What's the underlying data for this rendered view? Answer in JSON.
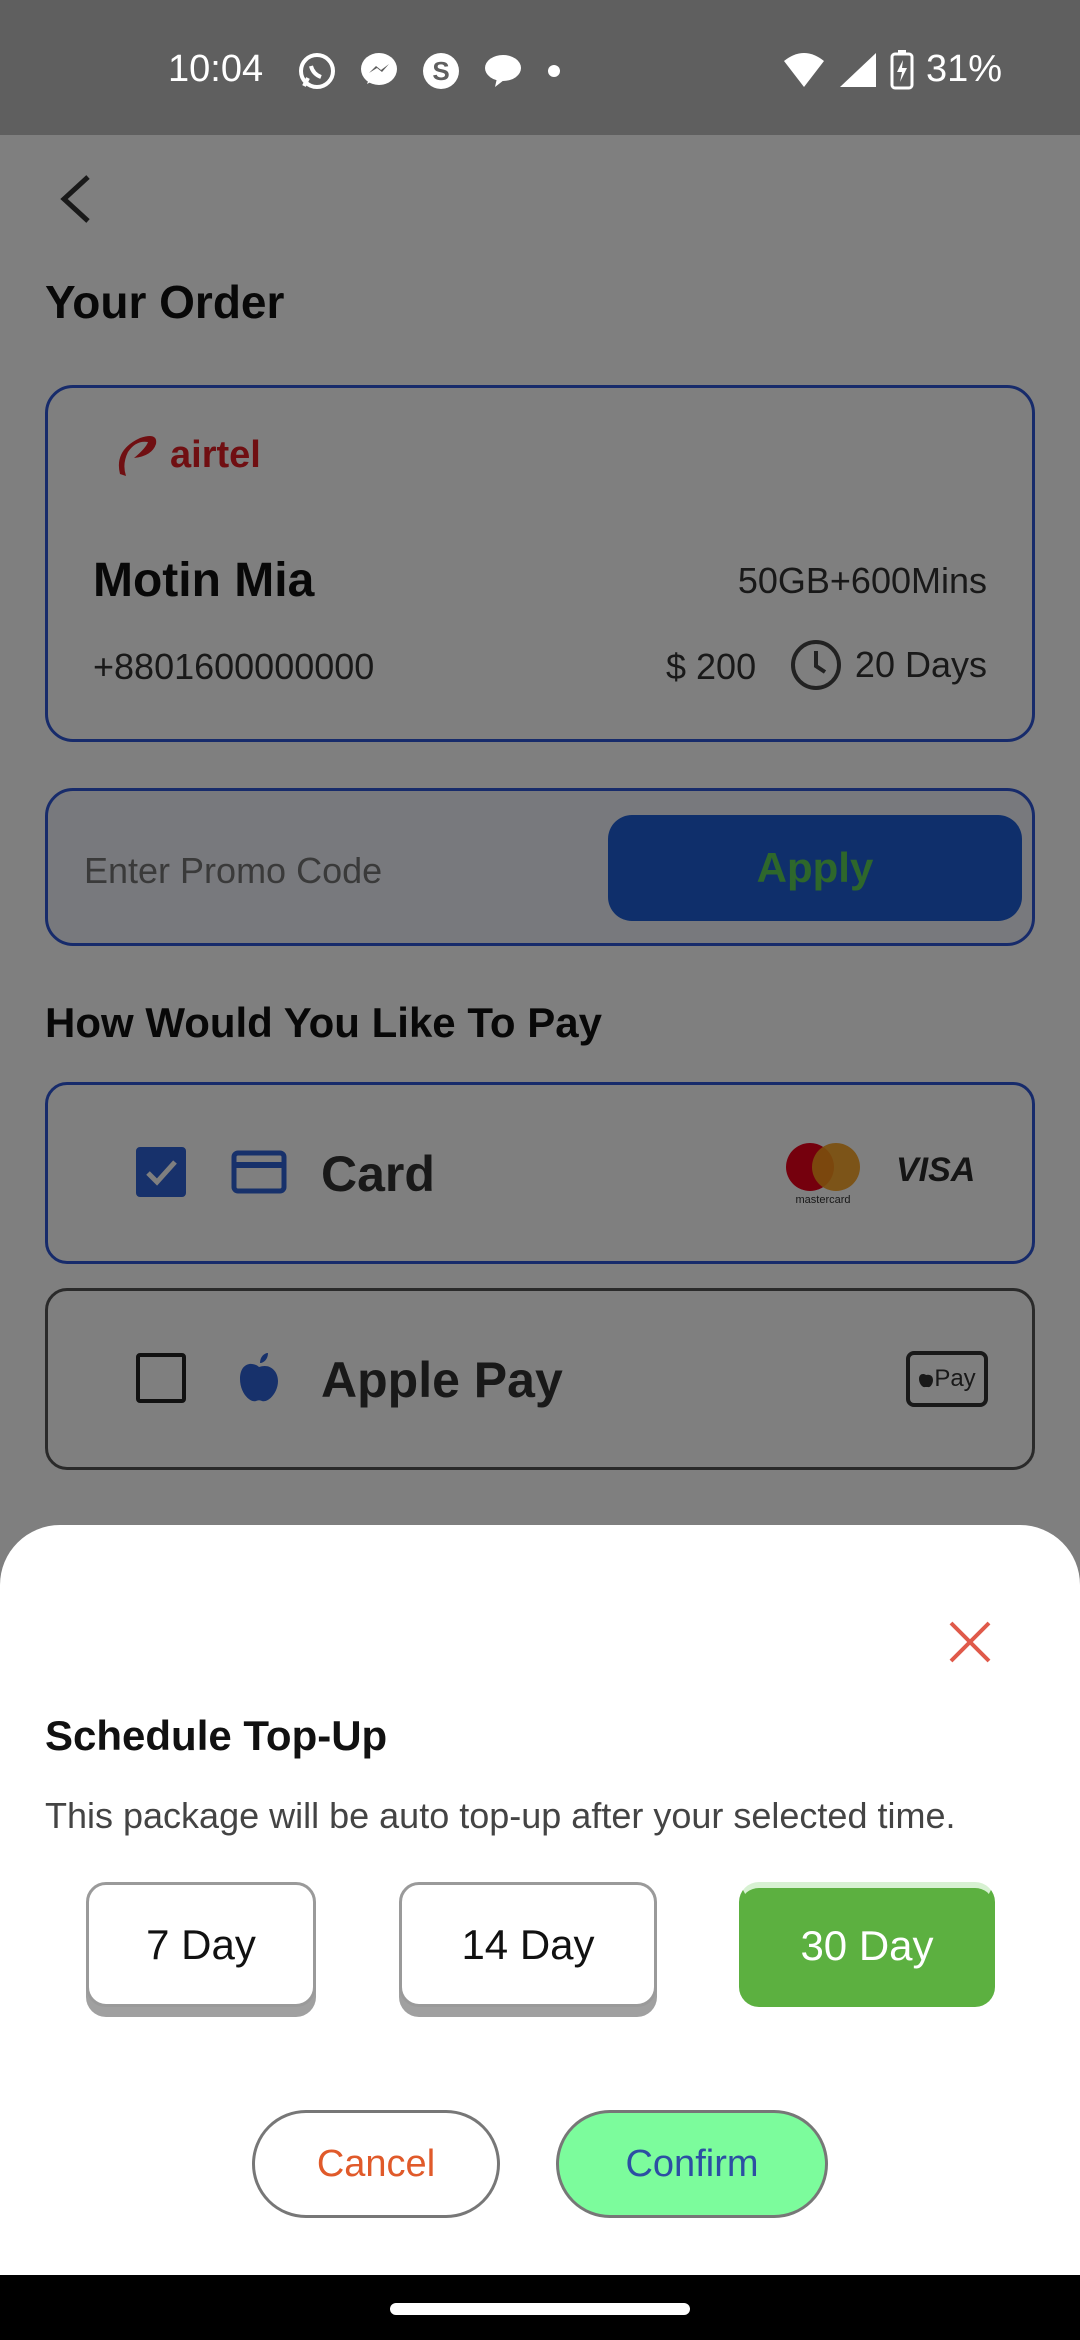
{
  "status_bar": {
    "time": "10:04",
    "battery": "31%",
    "left_icons": [
      "whatsapp-icon",
      "messenger-icon",
      "skype-icon",
      "chat-icon",
      "dot-icon"
    ],
    "right_icons": [
      "wifi-icon",
      "signal-icon",
      "battery-charging-icon"
    ]
  },
  "header": {
    "title": "Your Order"
  },
  "order": {
    "operator": "airtel",
    "name": "Motin Mia",
    "package": "50GB+600Mins",
    "phone": "+8801600000000",
    "price": "$ 200",
    "duration": "20 Days"
  },
  "promo": {
    "placeholder": "Enter Promo Code",
    "apply_label": "Apply"
  },
  "payment": {
    "title": "How Would You Like To Pay",
    "options": [
      {
        "label": "Card",
        "checked": true,
        "brands": [
          "mastercard",
          "VISA"
        ]
      },
      {
        "label": "Apple Pay",
        "checked": false,
        "badge": "Pay"
      }
    ]
  },
  "sheet": {
    "title": "Schedule Top-Up",
    "description": "This package will be auto top-up after your selected time.",
    "day_options": [
      {
        "label": "7 Day",
        "selected": false
      },
      {
        "label": "14 Day",
        "selected": false
      },
      {
        "label": "30 Day",
        "selected": true
      }
    ],
    "cancel_label": "Cancel",
    "confirm_label": "Confirm"
  },
  "colors": {
    "accent_blue": "#2e57d6",
    "selected_green": "#5cb040",
    "confirm_green": "#7cfc9c",
    "cancel_text": "#e05a2a",
    "close_red": "#e05a4a"
  }
}
